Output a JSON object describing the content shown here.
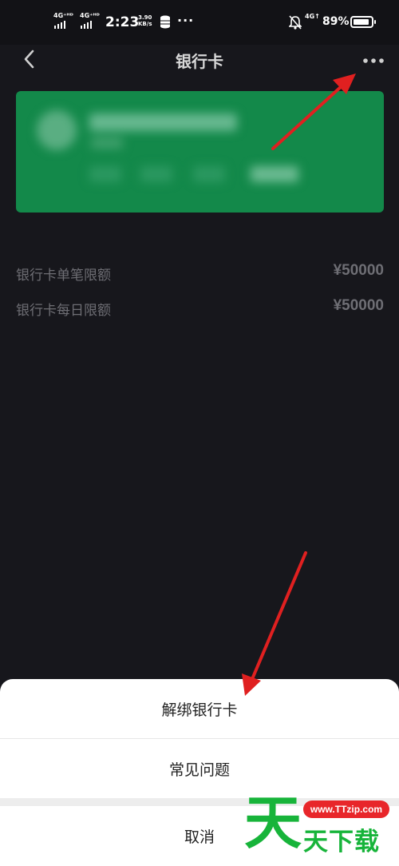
{
  "status_bar": {
    "network1": "4G⁺ᴴᴰ",
    "network2": "4G⁺ᴴᴰ",
    "time": "2:23",
    "speed_value": "3.90",
    "speed_unit": "KB/s",
    "more": "···",
    "net_right": "4G↑",
    "battery_text": "89%",
    "battery_level": 0.89
  },
  "nav": {
    "title": "银行卡",
    "back_icon": "chevron-left-icon",
    "more_icon": "more-dots-icon"
  },
  "card": {
    "color": "#13894a",
    "blurred": true
  },
  "limits": [
    {
      "label": "银行卡单笔限额",
      "value": "¥50000"
    },
    {
      "label": "银行卡每日限额",
      "value": "¥50000"
    }
  ],
  "sheet": {
    "unbind": "解绑银行卡",
    "faq": "常见问题",
    "cancel": "取消"
  },
  "watermark": {
    "big": "天",
    "url": "www.TTzip.com",
    "text": "天下载"
  },
  "colors": {
    "background": "#17171c",
    "arrow": "#e02020",
    "watermark_green": "#17b43a"
  }
}
